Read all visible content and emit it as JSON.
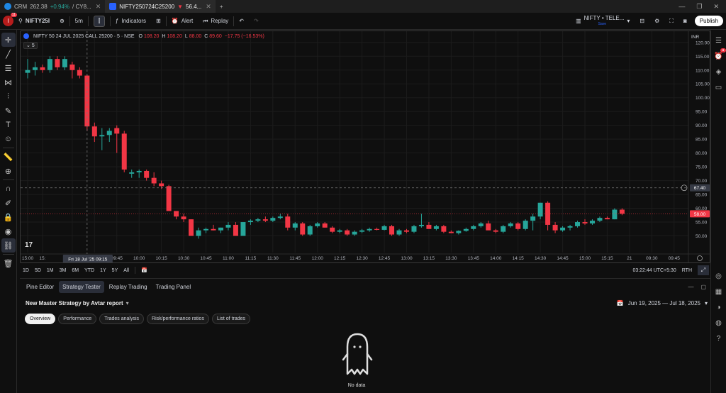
{
  "browser_tabs": [
    {
      "title": "CRM",
      "price": "262.38",
      "change": "+0.94%",
      "extra": "/ CY8...",
      "trend": "up"
    },
    {
      "title": "NIFTY250724C25200",
      "price": "56.4...",
      "change": "▼",
      "trend": "down",
      "active": true
    }
  ],
  "toolbar": {
    "avatar_letter": "I",
    "avatar_badge": "11",
    "symbol": "NIFTY25I",
    "interval": "5m",
    "indicators": "Indicators",
    "alert": "Alert",
    "replay": "Replay",
    "layout_name": "NIFTY • TELE...",
    "layout_sub": "Save",
    "publish": "Publish"
  },
  "legend": {
    "title": "NIFTY 50 24 JUL 2025 CALL 25200 · 5 · NSE",
    "o_label": "O",
    "o": "108.20",
    "h_label": "H",
    "h": "108.20",
    "l_label": "L",
    "l": "88.00",
    "c_label": "C",
    "c": "89.60",
    "change": "−17.75 (−16.53%)",
    "series_count": "5"
  },
  "chart_data": {
    "type": "candlestick",
    "currency": "INR",
    "ylim": [
      45,
      122
    ],
    "y_ticks": [
      50,
      55,
      60,
      65,
      70,
      75,
      80,
      85,
      90,
      95,
      100,
      105,
      110,
      115,
      120
    ],
    "y_tick_labels": [
      "50.00",
      "55.00",
      "60.00",
      "65.00",
      "70.00",
      "75.00",
      "80.00",
      "85.00",
      "90.00",
      "95.00",
      "100.00",
      "105.00",
      "110.00",
      "115.00",
      "120.00"
    ],
    "x_tick_labels": [
      "15:00",
      "15:",
      "09:15",
      "09:30",
      "09:45",
      "10:00",
      "10:15",
      "10:30",
      "10:45",
      "11:00",
      "11:15",
      "11:30",
      "11:45",
      "12:00",
      "12:15",
      "12:30",
      "12:45",
      "13:00",
      "13:15",
      "13:30",
      "13:45",
      "14:00",
      "14:15",
      "14:30",
      "14:45",
      "15:00",
      "15:15",
      "21",
      "09:30",
      "09:45"
    ],
    "x_tick_index": [
      0,
      2,
      6,
      9,
      12,
      15,
      18,
      21,
      24,
      27,
      30,
      33,
      36,
      39,
      42,
      45,
      48,
      51,
      54,
      57,
      60,
      63,
      66,
      69,
      72,
      75,
      78,
      81,
      84,
      87
    ],
    "crosshair_date": "Fri 18 Jul '25",
    "crosshair_time": "09:15",
    "crosshair_price": "67.40",
    "crosshair_price_value": 67.4,
    "last_price": "58.00",
    "last_price_value": 58.0,
    "candles": [
      {
        "o": 109,
        "h": 114,
        "l": 107,
        "c": 110
      },
      {
        "o": 110,
        "h": 113,
        "l": 108,
        "c": 111
      },
      {
        "o": 111,
        "h": 112,
        "l": 109,
        "c": 110
      },
      {
        "o": 110,
        "h": 115,
        "l": 109,
        "c": 114
      },
      {
        "o": 114,
        "h": 115,
        "l": 110,
        "c": 111
      },
      {
        "o": 111,
        "h": 115,
        "l": 110,
        "c": 114
      },
      {
        "o": 112,
        "h": 113,
        "l": 107,
        "c": 110
      },
      {
        "o": 110,
        "h": 111,
        "l": 107,
        "c": 108
      },
      {
        "o": 108,
        "h": 108.2,
        "l": 88,
        "c": 89.6
      },
      {
        "o": 89.6,
        "h": 91,
        "l": 84,
        "c": 86
      },
      {
        "o": 86,
        "h": 89,
        "l": 81,
        "c": 86.5
      },
      {
        "o": 86.5,
        "h": 89,
        "l": 84,
        "c": 88
      },
      {
        "o": 89,
        "h": 90,
        "l": 80,
        "c": 87
      },
      {
        "o": 87,
        "h": 88,
        "l": 73,
        "c": 74
      },
      {
        "o": 72.5,
        "h": 74,
        "l": 71,
        "c": 73
      },
      {
        "o": 73,
        "h": 74,
        "l": 71,
        "c": 73.5
      },
      {
        "o": 73.5,
        "h": 74,
        "l": 70,
        "c": 71
      },
      {
        "o": 71,
        "h": 73,
        "l": 68,
        "c": 69
      },
      {
        "o": 69,
        "h": 70,
        "l": 67,
        "c": 68
      },
      {
        "o": 68,
        "h": 68.5,
        "l": 62,
        "c": 59
      },
      {
        "o": 59,
        "h": 59,
        "l": 56,
        "c": 57
      },
      {
        "o": 57,
        "h": 58,
        "l": 55,
        "c": 56
      },
      {
        "o": 56,
        "h": 56,
        "l": 50,
        "c": 50
      },
      {
        "o": 50,
        "h": 53,
        "l": 49,
        "c": 52
      },
      {
        "o": 52,
        "h": 53,
        "l": 51,
        "c": 52.5
      },
      {
        "o": 52.5,
        "h": 54,
        "l": 52,
        "c": 52
      },
      {
        "o": 52,
        "h": 53,
        "l": 51,
        "c": 53
      },
      {
        "o": 53,
        "h": 55,
        "l": 52,
        "c": 54
      },
      {
        "o": 54,
        "h": 55,
        "l": 50,
        "c": 50
      },
      {
        "o": 50,
        "h": 55,
        "l": 50,
        "c": 55
      },
      {
        "o": 55,
        "h": 56,
        "l": 54,
        "c": 55.5
      },
      {
        "o": 55.5,
        "h": 56.5,
        "l": 55,
        "c": 56
      },
      {
        "o": 56,
        "h": 57,
        "l": 55,
        "c": 55.5
      },
      {
        "o": 55.5,
        "h": 57,
        "l": 55,
        "c": 56.5
      },
      {
        "o": 56.5,
        "h": 58,
        "l": 56,
        "c": 57
      },
      {
        "o": 57,
        "h": 58,
        "l": 52,
        "c": 53
      },
      {
        "o": 53,
        "h": 55,
        "l": 52,
        "c": 54.5
      },
      {
        "o": 54.5,
        "h": 55,
        "l": 50,
        "c": 50.5
      },
      {
        "o": 50.5,
        "h": 54,
        "l": 50,
        "c": 53.5
      },
      {
        "o": 53.5,
        "h": 55,
        "l": 53,
        "c": 54.5
      },
      {
        "o": 54.5,
        "h": 55,
        "l": 53,
        "c": 53
      },
      {
        "o": 53,
        "h": 53.5,
        "l": 51,
        "c": 51.5
      },
      {
        "o": 51.5,
        "h": 52.5,
        "l": 51,
        "c": 52
      },
      {
        "o": 52,
        "h": 52.5,
        "l": 50,
        "c": 50.5
      },
      {
        "o": 50.5,
        "h": 52,
        "l": 50,
        "c": 51.5
      },
      {
        "o": 51.5,
        "h": 52.5,
        "l": 51,
        "c": 52
      },
      {
        "o": 52,
        "h": 53,
        "l": 51.5,
        "c": 52.5
      },
      {
        "o": 52.5,
        "h": 53,
        "l": 52,
        "c": 52.2
      },
      {
        "o": 52.2,
        "h": 54,
        "l": 52,
        "c": 53.5
      },
      {
        "o": 53.5,
        "h": 54,
        "l": 50,
        "c": 50.5
      },
      {
        "o": 50.5,
        "h": 52.5,
        "l": 50,
        "c": 52
      },
      {
        "o": 52,
        "h": 52.5,
        "l": 51,
        "c": 51.5
      },
      {
        "o": 51.5,
        "h": 54,
        "l": 51,
        "c": 53.5
      },
      {
        "o": 53.5,
        "h": 58,
        "l": 53,
        "c": 54
      },
      {
        "o": 54,
        "h": 55,
        "l": 53,
        "c": 52.5
      },
      {
        "o": 52.5,
        "h": 54,
        "l": 52,
        "c": 53.5
      },
      {
        "o": 53.5,
        "h": 54,
        "l": 51,
        "c": 51.5
      },
      {
        "o": 51.5,
        "h": 52,
        "l": 51,
        "c": 51
      },
      {
        "o": 51,
        "h": 52,
        "l": 50.5,
        "c": 51.8
      },
      {
        "o": 51.8,
        "h": 53,
        "l": 51.5,
        "c": 52.5
      },
      {
        "o": 52.5,
        "h": 54,
        "l": 52,
        "c": 53.5
      },
      {
        "o": 53.5,
        "h": 55,
        "l": 53,
        "c": 54.5
      },
      {
        "o": 54.5,
        "h": 55.5,
        "l": 53,
        "c": 52
      },
      {
        "o": 52,
        "h": 52.5,
        "l": 51,
        "c": 51.5
      },
      {
        "o": 51.5,
        "h": 54,
        "l": 51,
        "c": 53.5
      },
      {
        "o": 53.5,
        "h": 55,
        "l": 53,
        "c": 54.5
      },
      {
        "o": 54.5,
        "h": 55,
        "l": 52,
        "c": 52.5
      },
      {
        "o": 52.5,
        "h": 56,
        "l": 52,
        "c": 55.5
      },
      {
        "o": 55.5,
        "h": 58,
        "l": 52,
        "c": 57
      },
      {
        "o": 57,
        "h": 62,
        "l": 56,
        "c": 62
      },
      {
        "o": 62,
        "h": 62.5,
        "l": 52,
        "c": 54
      },
      {
        "o": 54,
        "h": 55,
        "l": 51,
        "c": 52
      },
      {
        "o": 52,
        "h": 53.5,
        "l": 51.5,
        "c": 53
      },
      {
        "o": 53,
        "h": 54,
        "l": 52,
        "c": 53.5
      },
      {
        "o": 53.5,
        "h": 55.5,
        "l": 53,
        "c": 55
      },
      {
        "o": 55,
        "h": 56,
        "l": 54,
        "c": 54.5
      },
      {
        "o": 54.5,
        "h": 56,
        "l": 54,
        "c": 55.5
      },
      {
        "o": 55.5,
        "h": 57,
        "l": 55,
        "c": 56.5
      },
      {
        "o": 56.5,
        "h": 57,
        "l": 56,
        "c": 56
      },
      {
        "o": 56,
        "h": 60,
        "l": 56,
        "c": 59.5
      },
      {
        "o": 59.5,
        "h": 60,
        "l": 57.5,
        "c": 58
      }
    ]
  },
  "range_bar": {
    "ranges": [
      "1D",
      "5D",
      "1M",
      "3M",
      "6M",
      "YTD",
      "1Y",
      "5Y",
      "All"
    ],
    "clock": "03:22:44 UTC+5:30",
    "session": "RTH"
  },
  "bottom_panel": {
    "tabs": [
      "Pine Editor",
      "Strategy Tester",
      "Replay Trading",
      "Trading Panel"
    ],
    "active_tab": 1,
    "strategy_title": "New Master Strategy by Avtar report",
    "date_range": "Jun 19, 2025 — Jul 18, 2025",
    "subtabs": [
      "Overview",
      "Performance",
      "Trades analysis",
      "Risk/performance ratios",
      "List of trades"
    ],
    "active_subtab": 0,
    "empty_text": "No data"
  },
  "colors": {
    "up": "#26a69a",
    "down": "#f23645",
    "grid": "#1c1c1c",
    "accent": "#2962ff"
  }
}
